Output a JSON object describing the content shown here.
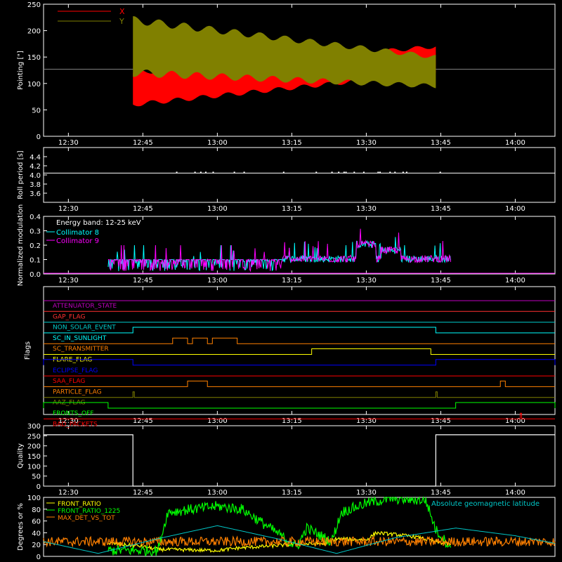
{
  "time_ticks": [
    "12:30",
    "12:45",
    "13:00",
    "13:15",
    "13:30",
    "13:45",
    "14:00"
  ],
  "colors": {
    "background": "#000000",
    "axes": "#ffffff",
    "x_pointing": "#ff0000",
    "y_pointing": "#808000",
    "collimator8": "#00ffff",
    "collimator9": "#ff00ff",
    "front_ratio": "#ffff00",
    "front_ratio_1225": "#00ff00",
    "max_det": "#ff8000",
    "geomag": "#00c8c8"
  },
  "chart_data": [
    {
      "type": "line",
      "panel": "pointing",
      "ylabel": "Pointing [\"]",
      "ylim": [
        0,
        250
      ],
      "yticks": [
        0,
        50,
        100,
        150,
        200,
        250
      ],
      "x_range": [
        "12:25",
        "14:08"
      ],
      "legend": [
        {
          "label": "X",
          "color": "#ff0000"
        },
        {
          "label": "Y",
          "color": "#808000"
        }
      ],
      "series": [
        {
          "name": "X",
          "start": "12:43",
          "end": "13:44",
          "start_band": [
            60,
            120
          ],
          "end_band": [
            120,
            170
          ]
        },
        {
          "name": "Y",
          "start": "12:43",
          "end": "13:44",
          "start_band": [
            120,
            220
          ],
          "end_band": [
            95,
            150
          ]
        }
      ],
      "reference_line": 127
    },
    {
      "type": "line",
      "panel": "roll",
      "ylabel": "Roll period [s]",
      "ylim": [
        3.4,
        4.6
      ],
      "yticks": [
        3.6,
        3.8,
        4.0,
        4.2,
        4.4
      ],
      "series": [
        {
          "value": 4.04
        }
      ]
    },
    {
      "type": "line",
      "panel": "modulation",
      "ylabel": "Normalized modulation",
      "ylim": [
        0,
        0.4
      ],
      "yticks": [
        0,
        0.1,
        0.2,
        0.3,
        0.4
      ],
      "annotations": [
        "Energy band: 12-25 keV"
      ],
      "legend": [
        {
          "label": "Collimator 8",
          "color": "#00ffff"
        },
        {
          "label": "Collimator 9",
          "color": "#ff00ff"
        }
      ],
      "series": [
        {
          "name": "Collimator 8",
          "start": "12:38",
          "end": "13:47"
        },
        {
          "name": "Collimator 9",
          "start": "12:38",
          "end": "13:47"
        }
      ]
    },
    {
      "type": "line",
      "panel": "flags",
      "ylabel": "Flags",
      "flags": [
        {
          "label": "ATTENUATOR_STATE",
          "color": "#c000c0",
          "segments": []
        },
        {
          "label": "GAP_FLAG",
          "color": "#ff3030",
          "segments": []
        },
        {
          "label": "NON_SOLAR_EVENT",
          "color": "#00c8c8",
          "segments": []
        },
        {
          "label": "SC_IN_SUNLIGHT",
          "color": "#00ffff",
          "segments": [
            [
              "12:43",
              "13:44"
            ]
          ]
        },
        {
          "label": "SC_TRANSMITTER",
          "color": "#ff8000",
          "segments": [
            [
              "12:51",
              "12:54"
            ],
            [
              "12:55",
              "12:58"
            ],
            [
              "12:59",
              "13:04"
            ]
          ]
        },
        {
          "label": "FLARE_FLAG",
          "color": "#ffff00",
          "segments": [
            [
              "13:19",
              "13:43"
            ]
          ]
        },
        {
          "label": "ECLIPSE_FLAG",
          "color": "#0000ff",
          "segments": [
            [
              "12:25",
              "12:43"
            ],
            [
              "13:44",
              "14:08"
            ]
          ]
        },
        {
          "label": "SAA_FLAG",
          "color": "#ff0000",
          "segments": []
        },
        {
          "label": "PARTICLE_FLAG",
          "color": "#ff8000",
          "segments": [
            [
              "12:54",
              "12:58"
            ],
            [
              "13:57",
              "13:58"
            ]
          ]
        },
        {
          "label": "AAZ_FLAG",
          "color": "#808000",
          "segments": [
            [
              "12:43",
              "12:43"
            ],
            [
              "13:44",
              "13:44"
            ]
          ]
        },
        {
          "label": "FRONTS_OFF",
          "color": "#00ff00",
          "segments": [
            [
              "12:25",
              "12:38"
            ],
            [
              "13:48",
              "14:08"
            ]
          ]
        },
        {
          "label": "BAD_PACKETS",
          "color": "#ff0000",
          "segments": [
            [
              "14:01",
              "14:01"
            ]
          ]
        }
      ]
    },
    {
      "type": "line",
      "panel": "quality",
      "ylabel": "Quality",
      "ylim": [
        0,
        300
      ],
      "yticks": [
        0,
        50,
        100,
        150,
        200,
        250,
        300
      ],
      "series": [
        {
          "name": "Quality",
          "x": [
            "12:25",
            "12:43",
            "12:43",
            "13:44",
            "13:44",
            "14:08"
          ],
          "y": [
            255,
            255,
            0,
            0,
            255,
            255
          ]
        }
      ]
    },
    {
      "type": "line",
      "panel": "ratios",
      "ylabel": "Degrees or %",
      "ylim": [
        0,
        100
      ],
      "yticks": [
        0,
        20,
        40,
        60,
        80,
        100
      ],
      "legend": [
        {
          "label": "FRONT_RATIO",
          "color": "#ffff00"
        },
        {
          "label": "FRONT_RATIO_1225",
          "color": "#00ff00"
        },
        {
          "label": "MAX_DET_VS_TOT",
          "color": "#ff8000"
        },
        {
          "label": "Absolute geomagnetic latitude",
          "color": "#00c8c8"
        }
      ],
      "series": [
        {
          "name": "FRONT_RATIO",
          "x": [
            "12:38",
            "12:44",
            "12:48",
            "13:00",
            "13:04",
            "13:15",
            "13:22",
            "13:24",
            "13:30",
            "13:32",
            "13:36",
            "13:40",
            "13:44",
            "13:47"
          ],
          "y": [
            22,
            18,
            12,
            10,
            14,
            20,
            22,
            30,
            28,
            40,
            37,
            33,
            25,
            20
          ]
        },
        {
          "name": "FRONT_RATIO_1225",
          "x": [
            "12:38",
            "12:48",
            "12:50",
            "13:00",
            "13:05",
            "13:12",
            "13:16",
            "13:18",
            "13:23",
            "13:25",
            "13:30",
            "13:35",
            "13:42",
            "13:44",
            "13:47"
          ],
          "y": [
            10,
            10,
            75,
            85,
            80,
            40,
            15,
            48,
            25,
            75,
            90,
            98,
            95,
            45,
            15
          ]
        },
        {
          "name": "MAX_DET_VS_TOT",
          "x": [
            "12:25",
            "13:00",
            "13:30",
            "14:00",
            "14:08"
          ],
          "y": [
            25,
            25,
            25,
            25,
            25
          ]
        },
        {
          "name": "Absolute geomagnetic latitude",
          "x": [
            "12:25",
            "12:36",
            "12:48",
            "13:00",
            "13:12",
            "13:24",
            "13:36",
            "13:48",
            "14:00",
            "14:08"
          ],
          "y": [
            25,
            5,
            30,
            52,
            30,
            5,
            32,
            48,
            35,
            22
          ]
        }
      ]
    }
  ]
}
